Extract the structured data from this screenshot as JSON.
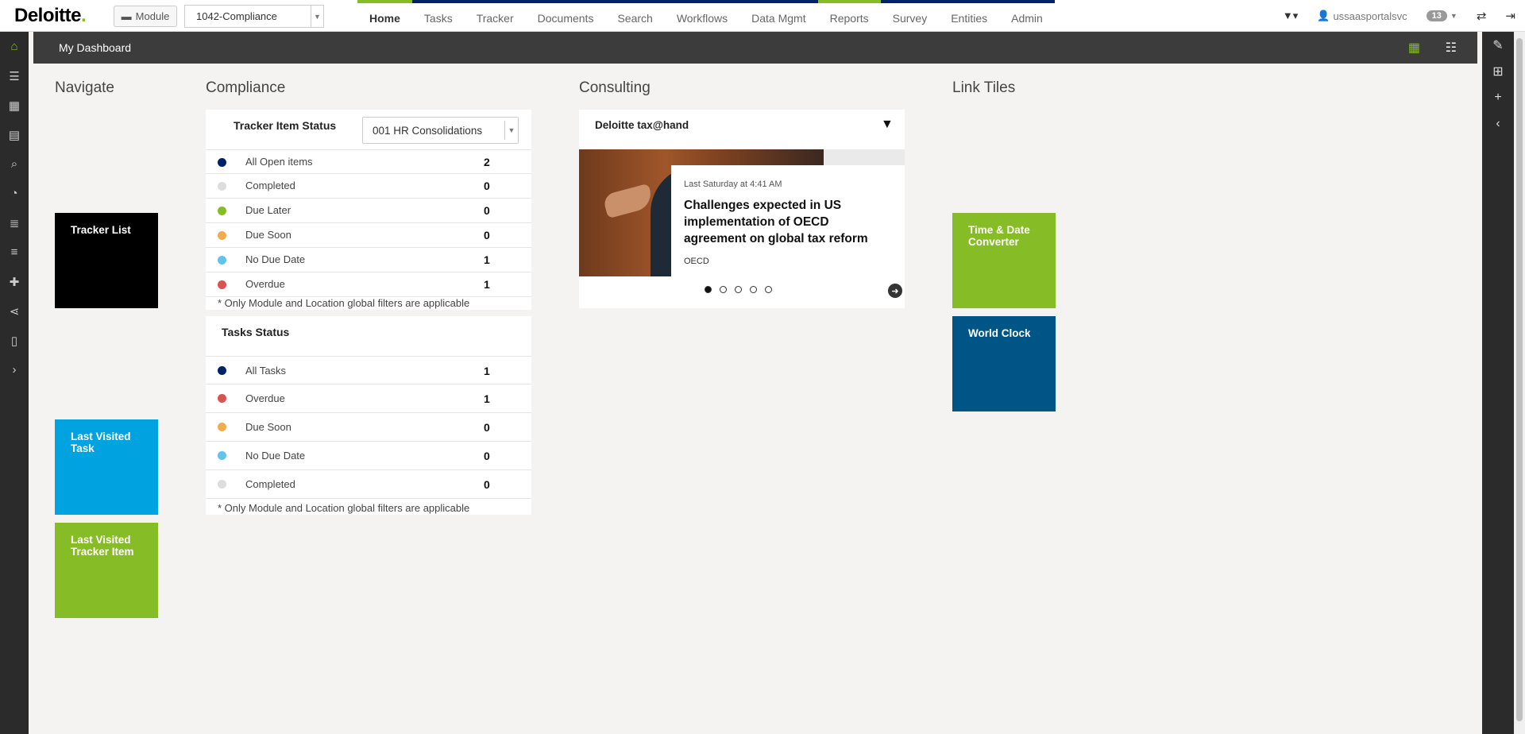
{
  "brand": {
    "name": "Deloitte",
    "dot": "."
  },
  "topbar": {
    "module_label": "Module",
    "module_value": "1042-Compliance",
    "nav": [
      {
        "label": "Home",
        "active": true
      },
      {
        "label": "Tasks"
      },
      {
        "label": "Tracker"
      },
      {
        "label": "Documents"
      },
      {
        "label": "Search"
      },
      {
        "label": "Workflows"
      },
      {
        "label": "Data Mgmt"
      },
      {
        "label": "Reports"
      },
      {
        "label": "Survey"
      },
      {
        "label": "Entities"
      },
      {
        "label": "Admin"
      }
    ],
    "user": "ussaasportalsvc",
    "notifications": "13"
  },
  "dashboard": {
    "title": "My Dashboard"
  },
  "sections": {
    "navigate": "Navigate",
    "compliance": "Compliance",
    "consulting": "Consulting",
    "link_tiles": "Link Tiles"
  },
  "navigate_tiles": {
    "tracker_list": "Tracker List",
    "last_visited_task": "Last Visited Task",
    "last_visited_tracker_item": "Last Visited Tracker Item"
  },
  "tracker_status": {
    "title": "Tracker Item Status",
    "dropdown_value": "001 HR Consolidations",
    "rows": [
      {
        "label": "All Open items",
        "count": "2",
        "color": "#012169"
      },
      {
        "label": "Completed",
        "count": "0",
        "color": "#dddddd"
      },
      {
        "label": "Due Later",
        "count": "0",
        "color": "#86bc25"
      },
      {
        "label": "Due Soon",
        "count": "0",
        "color": "#f0ad4e"
      },
      {
        "label": "No Due Date",
        "count": "1",
        "color": "#62c3eb"
      },
      {
        "label": "Overdue",
        "count": "1",
        "color": "#d9534f"
      }
    ],
    "note": "* Only Module and Location global filters are applicable"
  },
  "tasks_status": {
    "title": "Tasks Status",
    "rows": [
      {
        "label": "All Tasks",
        "count": "1",
        "color": "#012169"
      },
      {
        "label": "Overdue",
        "count": "1",
        "color": "#d9534f"
      },
      {
        "label": "Due Soon",
        "count": "0",
        "color": "#f0ad4e"
      },
      {
        "label": "No Due Date",
        "count": "0",
        "color": "#62c3eb"
      },
      {
        "label": "Completed",
        "count": "0",
        "color": "#dddddd"
      }
    ],
    "note": "* Only Module and Location global filters are applicable"
  },
  "consulting": {
    "source": "Deloitte tax@hand",
    "time": "Last Saturday at 4:41 AM",
    "headline": "Challenges expected in US implementation of OECD agreement on global tax reform",
    "tag": "OECD"
  },
  "link_tiles": {
    "time_date": "Time & Date Converter",
    "world_clock": "World Clock"
  },
  "colors": {
    "green": "#86bc25",
    "navy": "#012169",
    "blue_tile": "#00a3e0",
    "dark_blue_tile": "#005587",
    "black_tile": "#000000"
  }
}
